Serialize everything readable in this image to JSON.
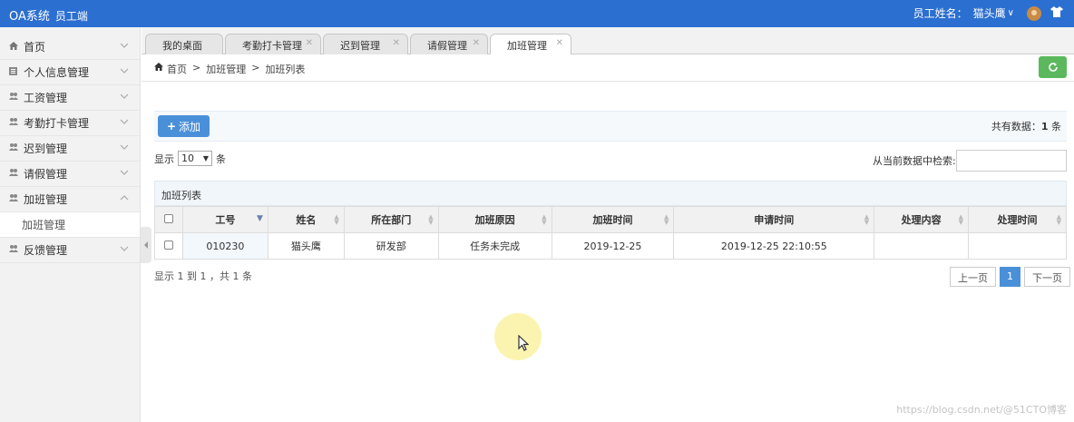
{
  "header": {
    "app_title": "OA系统",
    "app_subtitle": "员工端",
    "user_prefix": "员工姓名：",
    "user_name": "猫头鹰",
    "user_caret": "∨",
    "shirt_icon": "shirt-icon",
    "color": "#2b6fd1"
  },
  "sidebar": {
    "items": [
      {
        "label": "首页",
        "icon": "home-icon",
        "expanded": false
      },
      {
        "label": "个人信息管理",
        "icon": "list-icon",
        "expanded": false
      },
      {
        "label": "工资管理",
        "icon": "users-icon",
        "expanded": false
      },
      {
        "label": "考勤打卡管理",
        "icon": "users-icon",
        "expanded": false
      },
      {
        "label": "迟到管理",
        "icon": "users-icon",
        "expanded": false
      },
      {
        "label": "请假管理",
        "icon": "users-icon",
        "expanded": false
      },
      {
        "label": "加班管理",
        "icon": "users-icon",
        "expanded": true
      },
      {
        "label": "反馈管理",
        "icon": "users-icon",
        "expanded": false
      }
    ],
    "submenu": [
      "加班管理"
    ]
  },
  "tabs": [
    {
      "label": "我的桌面",
      "closable": false,
      "active": false
    },
    {
      "label": "考勤打卡管理",
      "closable": true,
      "active": false
    },
    {
      "label": "迟到管理",
      "closable": true,
      "active": false
    },
    {
      "label": "请假管理",
      "closable": true,
      "active": false
    },
    {
      "label": "加班管理",
      "closable": true,
      "active": true
    }
  ],
  "breadcrumb": {
    "home": "首页",
    "sep": ">",
    "level1": "加班管理",
    "level2": "加班列表"
  },
  "toolbar": {
    "add_label": "添加",
    "total_prefix": "共有数据：",
    "total_count": "1",
    "total_suffix": "条",
    "refresh_color": "#5cb85c"
  },
  "list_controls": {
    "show_prefix": "显示",
    "page_size": "10",
    "show_suffix": "条",
    "search_label": "从当前数据中检索:"
  },
  "table": {
    "title": "加班列表",
    "columns": [
      "工号",
      "姓名",
      "所在部门",
      "加班原因",
      "加班时间",
      "申请时间",
      "处理内容",
      "处理时间"
    ],
    "rows": [
      [
        "010230",
        "猫头鹰",
        "研发部",
        "任务未完成",
        "2019-12-25",
        "2019-12-25 22:10:55",
        "",
        ""
      ]
    ]
  },
  "pagination": {
    "info": "显示 1 到 1 ，共 1 条",
    "prev": "上一页",
    "current": "1",
    "next": "下一页"
  },
  "watermark": "https://blog.csdn.net/@51CTO博客"
}
